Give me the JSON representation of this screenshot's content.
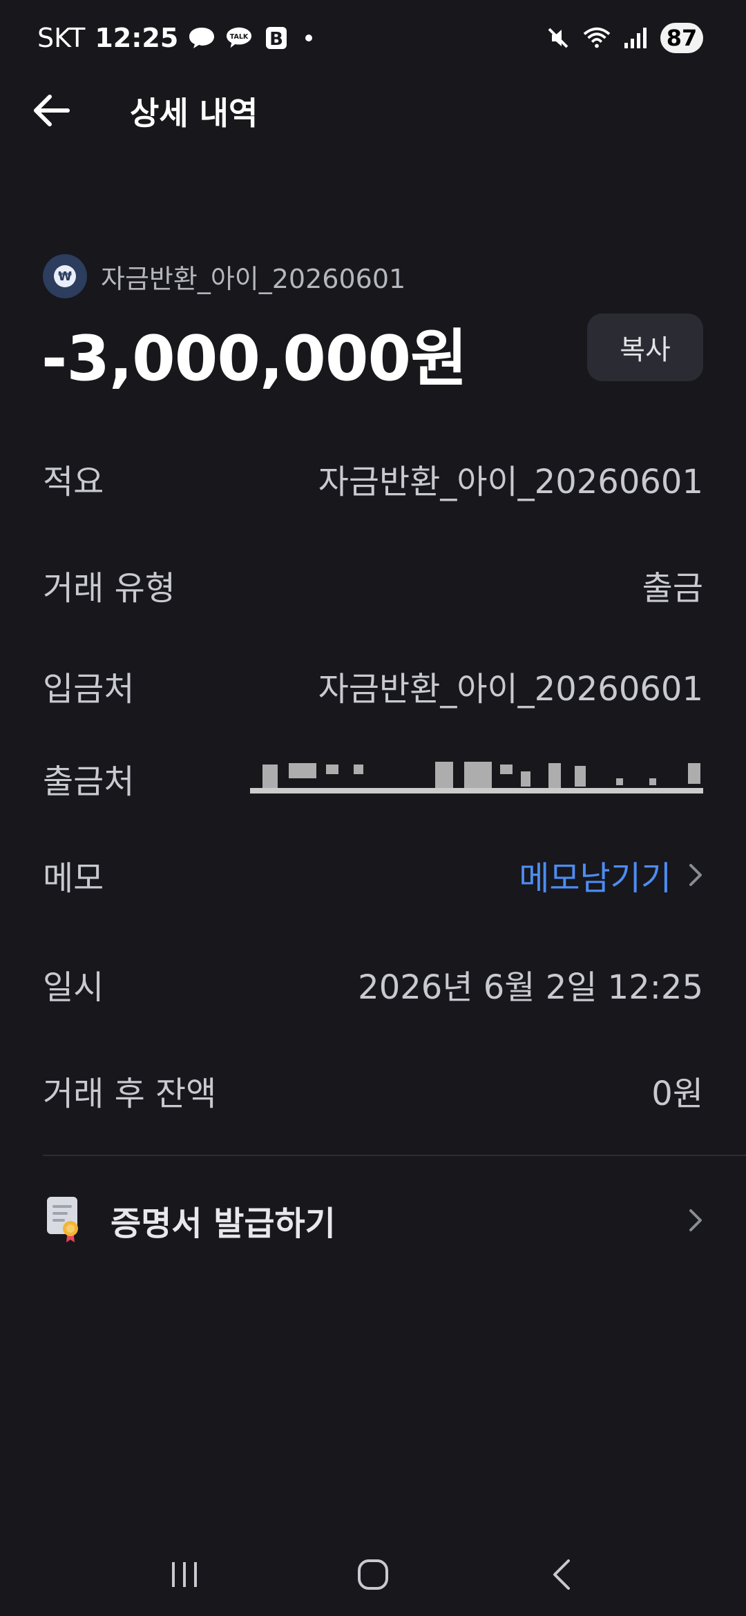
{
  "status_bar": {
    "carrier": "SKT",
    "time": "12:25",
    "battery": "87"
  },
  "header": {
    "title": "상세 내역"
  },
  "summary": {
    "name": "자금반환_아이_20260601",
    "amount": "-3,000,000원",
    "copy_label": "복사"
  },
  "details": [
    {
      "label": "적요",
      "value": "자금반환_아이_20260601"
    },
    {
      "label": "거래 유형",
      "value": "출금"
    },
    {
      "label": "입금처",
      "value": "자금반환_아이_20260601"
    },
    {
      "label": "출금처",
      "value": ""
    },
    {
      "label": "메모",
      "value": "메모남기기"
    },
    {
      "label": "일시",
      "value": "2026년 6월 2일 12:25"
    },
    {
      "label": "거래 후 잔액",
      "value": "0원"
    }
  ],
  "certificate": {
    "label": "증명서 발급하기"
  },
  "colors": {
    "background": "#17171c",
    "link": "#4e8cf2",
    "button_bg": "#2b2c33"
  },
  "icons": {
    "back": "arrow-left-icon",
    "chevron": "chevron-right-icon",
    "certificate": "certificate-icon"
  }
}
